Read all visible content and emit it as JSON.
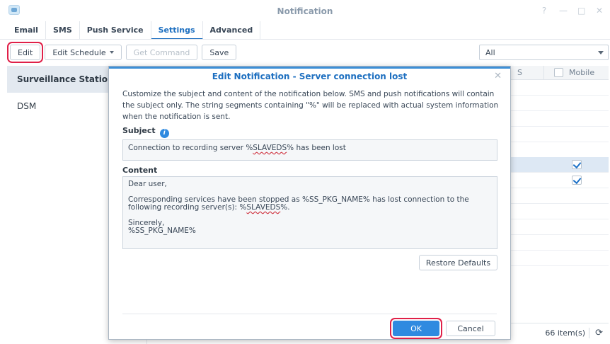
{
  "window": {
    "title": "Notification",
    "controls": [
      "?",
      "—",
      "□",
      "✕"
    ]
  },
  "tabs": [
    "Email",
    "SMS",
    "Push Service",
    "Settings",
    "Advanced"
  ],
  "active_tab": "Settings",
  "toolbar": {
    "edit": "Edit",
    "edit_schedule": "Edit Schedule",
    "get_command": "Get Command",
    "save": "Save"
  },
  "filter": {
    "value": "All"
  },
  "categories": [
    {
      "label": "Surveillance Station",
      "selected": true
    },
    {
      "label": "DSM",
      "selected": false
    }
  ],
  "grid": {
    "header_partial": "S",
    "mobile_header": "Mobile",
    "checked_rows": [
      true,
      true
    ],
    "item_count": "66 item(s)"
  },
  "modal": {
    "title": "Edit Notification - Server connection lost",
    "description": "Customize the subject and content of the notification below. SMS and push notifications will contain the subject only. The string segments containing \"%\" will be replaced with actual system information when the notification is sent.",
    "subject_label": "Subject",
    "subject_prefix": "Connection to recording server %",
    "subject_var": "SLAVEDS",
    "subject_suffix": "% has been lost",
    "content_label": "Content",
    "content_line1": "Dear user,",
    "content_line2": "Corresponding services have been stopped as %SS_PKG_NAME% has lost connection to the",
    "content_line3_prefix": "following recording server(s): %",
    "content_line3_var": "SLAVEDS",
    "content_line3_suffix": "%.",
    "content_line4": "Sincerely,",
    "content_line5": "%SS_PKG_NAME%",
    "restore_defaults": "Restore Defaults",
    "ok": "OK",
    "cancel": "Cancel"
  },
  "colors": {
    "accent": "#1d6fc0",
    "primary_button": "#2f8ae0",
    "highlight_box": "#e02048"
  }
}
